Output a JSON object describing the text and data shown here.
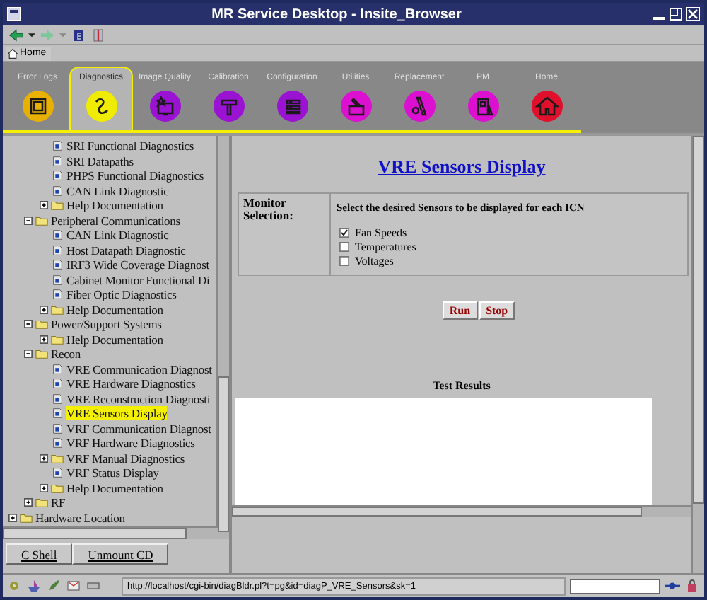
{
  "window": {
    "title": "MR Service Desktop - Insite_Browser"
  },
  "location_bar": {
    "label": "Home"
  },
  "nav": [
    {
      "label": "Error Logs",
      "selected": false,
      "color": "#e8b000"
    },
    {
      "label": "Diagnostics",
      "selected": true,
      "color": "#f0ec00"
    },
    {
      "label": "Image Quality",
      "selected": false,
      "color": "#9a12d2"
    },
    {
      "label": "Calibration",
      "selected": false,
      "color": "#9a12d2"
    },
    {
      "label": "Configuration",
      "selected": false,
      "color": "#9a12d2"
    },
    {
      "label": "Utilities",
      "selected": false,
      "color": "#dc10d0"
    },
    {
      "label": "Replacement",
      "selected": false,
      "color": "#dc10d0"
    },
    {
      "label": "PM",
      "selected": false,
      "color": "#dc10d0"
    },
    {
      "label": "Home",
      "selected": false,
      "color": "#e0102c"
    }
  ],
  "tree": {
    "items": [
      {
        "children": [
          {
            "children": [
              {
                "label": "SRI Functional Diagnostics",
                "kind": "page",
                "selected": false
              },
              {
                "label": "SRI Datapaths",
                "kind": "page",
                "selected": false
              },
              {
                "label": "PHPS Functional Diagnostics",
                "kind": "page",
                "selected": false
              },
              {
                "label": "CAN Link Diagnostic",
                "kind": "page",
                "selected": false
              },
              {
                "label": "Help Documentation",
                "kind": "folder",
                "expanded": false,
                "selected": false
              }
            ]
          },
          {
            "label": "Peripheral Communications",
            "kind": "folder",
            "expanded": true,
            "selected": false,
            "children": [
              {
                "label": "CAN Link Diagnostic",
                "kind": "page",
                "selected": false
              },
              {
                "label": "Host Datapath Diagnostic",
                "kind": "page",
                "selected": false
              },
              {
                "label": "IRF3 Wide Coverage Diagnost",
                "kind": "page",
                "selected": false
              },
              {
                "label": "Cabinet Monitor Functional Di",
                "kind": "page",
                "selected": false
              },
              {
                "label": "Fiber Optic Diagnostics",
                "kind": "page",
                "selected": false
              },
              {
                "label": "Help Documentation",
                "kind": "folder",
                "expanded": false,
                "selected": false
              }
            ]
          },
          {
            "label": "Power/Support Systems",
            "kind": "folder",
            "expanded": true,
            "selected": false,
            "children": [
              {
                "label": "Help Documentation",
                "kind": "folder",
                "expanded": false,
                "selected": false
              }
            ]
          },
          {
            "label": "Recon",
            "kind": "folder",
            "expanded": true,
            "selected": false,
            "children": [
              {
                "label": "VRE Communication Diagnost",
                "kind": "page",
                "selected": false
              },
              {
                "label": "VRE Hardware Diagnostics",
                "kind": "page",
                "selected": false
              },
              {
                "label": "VRE Reconstruction Diagnosti",
                "kind": "page",
                "selected": false
              },
              {
                "label": "VRE Sensors Display",
                "kind": "page",
                "selected": true
              },
              {
                "label": "VRF Communication Diagnost",
                "kind": "page",
                "selected": false
              },
              {
                "label": "VRF Hardware Diagnostics",
                "kind": "page",
                "selected": false
              },
              {
                "label": "VRF Manual Diagnostics",
                "kind": "folder",
                "expanded": false,
                "selected": false
              },
              {
                "label": "VRF Status Display",
                "kind": "page",
                "selected": false
              },
              {
                "label": "Help Documentation",
                "kind": "folder",
                "expanded": false,
                "selected": false
              }
            ]
          },
          {
            "label": "RF",
            "kind": "folder",
            "expanded": false,
            "selected": false
          }
        ]
      },
      {
        "label": "Hardware Location",
        "kind": "folder",
        "expanded": false,
        "selected": false
      }
    ]
  },
  "page": {
    "title": "VRE Sensors Display",
    "selection_label": "Monitor Selection:",
    "instruction": "Select the desired Sensors to be displayed for each ICN",
    "sensors": [
      {
        "label": "Fan Speeds",
        "checked": true
      },
      {
        "label": "Temperatures",
        "checked": false
      },
      {
        "label": "Voltages",
        "checked": false
      }
    ],
    "buttons": [
      "Run",
      "Stop"
    ],
    "results_title": "Test Results"
  },
  "side_buttons": [
    "C Shell",
    "Unmount CD"
  ],
  "status_bar": {
    "url": "http://localhost/cgi-bin/diagBldr.pl?t=pg&id=diagP_VRE_Sensors&sk=1"
  }
}
